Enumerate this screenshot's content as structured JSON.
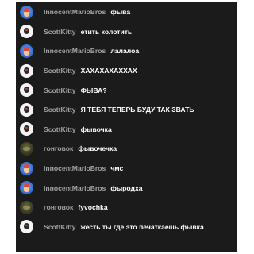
{
  "messages": [
    {
      "author": "InnocentMarioBros",
      "avatar": "mario-avatar",
      "text": "фыва"
    },
    {
      "author": "ScottKitty",
      "avatar": "kitty-avatar",
      "text": "етить колотить"
    },
    {
      "author": "InnocentMarioBros",
      "avatar": "mario-avatar",
      "text": "лалалоа"
    },
    {
      "author": "ScottKitty",
      "avatar": "kitty-avatar",
      "text": "ХАХАХАХАХХАХ"
    },
    {
      "author": "ScottKitty",
      "avatar": "kitty-avatar",
      "text": "ФЫВА?"
    },
    {
      "author": "ScottKitty",
      "avatar": "kitty-avatar",
      "text": "Я ТЕБЯ ТЕПЕРЬ БУДУ ТАК ЗВАТЬ"
    },
    {
      "author": "ScottKitty",
      "avatar": "kitty-avatar",
      "text": "фывочка"
    },
    {
      "author": "гонговок",
      "avatar": "gong-avatar",
      "text": "фывочечка"
    },
    {
      "author": "InnocentMarioBros",
      "avatar": "mario-avatar",
      "text": "чмс"
    },
    {
      "author": "InnocentMarioBros",
      "avatar": "mario-avatar",
      "text": "фыродха"
    },
    {
      "author": "гонговок",
      "avatar": "gong-avatar",
      "text": "fyvochka"
    },
    {
      "author": "ScottKitty",
      "avatar": "kitty-avatar",
      "text": "жесть ты где это печаткаешь фывка"
    }
  ],
  "colors": {
    "background": "#1b1b1b",
    "author": "#a3a3a3",
    "message": "#ffffff"
  }
}
